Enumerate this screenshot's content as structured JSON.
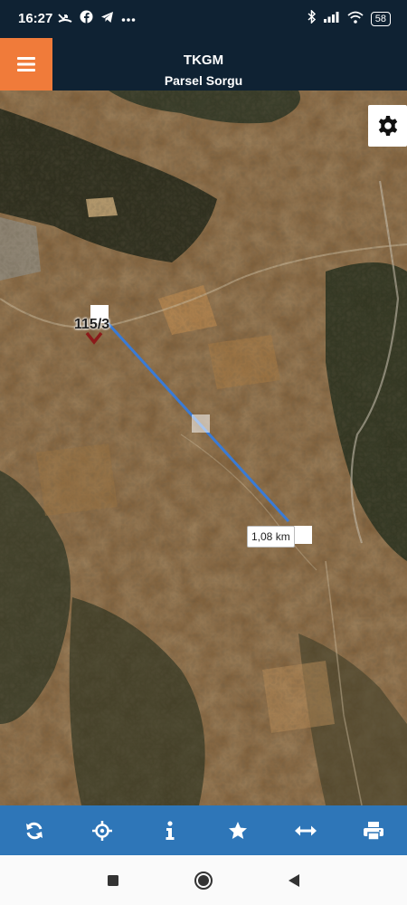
{
  "status_bar": {
    "time": "16:27",
    "battery": "58",
    "left_icons": [
      "missed-call-icon",
      "facebook-icon",
      "telegram-icon",
      "more-dots-icon"
    ],
    "right_icons": [
      "bluetooth-icon",
      "signal-icon",
      "wifi-icon",
      "battery-icon"
    ]
  },
  "header": {
    "title": "TKGM",
    "subtitle": "Parsel Sorgu",
    "menu_icon": "hamburger-icon",
    "accent_color": "#f07b3a",
    "bar_color": "#0f2233"
  },
  "map": {
    "parcel_label": "115/3",
    "distance_label": "1,08 km",
    "measure_line_color": "#3a7bd5",
    "settings_icon": "gear-icon"
  },
  "toolbar": {
    "color": "#2e76b8",
    "tools": [
      {
        "name": "refresh",
        "icon": "refresh-icon"
      },
      {
        "name": "locate",
        "icon": "crosshair-icon"
      },
      {
        "name": "info",
        "icon": "info-icon"
      },
      {
        "name": "favorites",
        "icon": "star-icon"
      },
      {
        "name": "measure",
        "icon": "arrows-horizontal-icon"
      },
      {
        "name": "print",
        "icon": "print-icon"
      }
    ]
  },
  "nav_bar": {
    "buttons": [
      "recents-icon",
      "home-icon",
      "back-icon"
    ]
  }
}
